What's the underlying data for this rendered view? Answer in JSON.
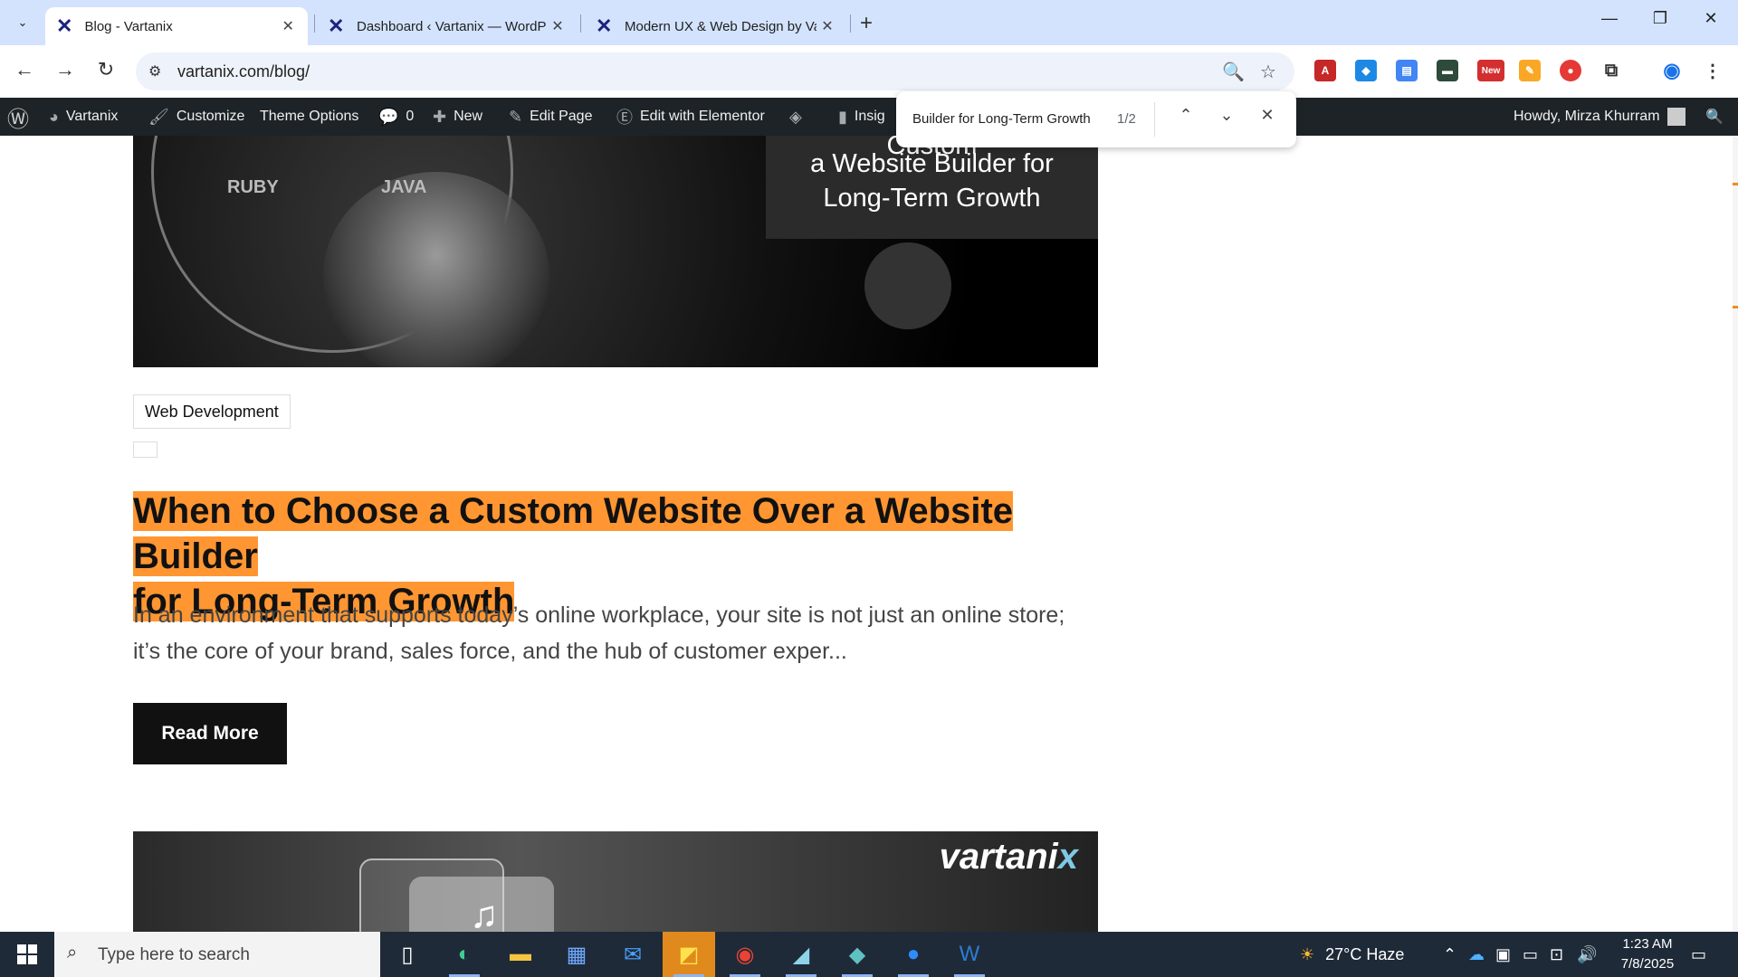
{
  "browser": {
    "tabs": [
      {
        "title": "Blog - Vartanix",
        "active": true
      },
      {
        "title": "Dashboard ‹ Vartanix — WordPress",
        "active": false
      },
      {
        "title": "Modern UX & Web Design by Vartanix",
        "active": false
      }
    ],
    "url": "vartanix.com/blog/",
    "extension_new_badge": "New"
  },
  "adminbar": {
    "site_name": "Vartanix",
    "customize": "Customize",
    "theme_options": "Theme Options",
    "comments_count": "0",
    "new": "New",
    "edit_page": "Edit Page",
    "edit_elementor": "Edit with Elementor",
    "insights": "Insig",
    "howdy": "Howdy, Mirza Khurram"
  },
  "findbar": {
    "query": "Builder for Long-Term Growth",
    "count": "1/2"
  },
  "post": {
    "hero_panel_line1": "Custom",
    "hero_panel_line2": "a Website Builder for",
    "hero_panel_line3": "Long-Term Growth",
    "hero_lang_1": "RUBY",
    "hero_lang_2": "JAVA",
    "category": "Web Development",
    "title_line1": "When to Choose a Custom Website Over a Website Builder",
    "title_line2": "for Long-Term Growth",
    "excerpt": "In an environment that supports today’s online workplace, your site is not just an online store; it’s the core of your brand, sales force, and the hub of customer exper...",
    "read_more": "Read More",
    "next_logo": "vartani",
    "next_logo_x": "x"
  },
  "taskbar": {
    "search_placeholder": "Type here to search",
    "weather": "27°C  Haze",
    "time": "1:23 AM",
    "date": "7/8/2025"
  },
  "colors": {
    "highlight": "#ff9632",
    "adminbar": "#1d2327",
    "tabstrip": "#d3e3fd"
  }
}
